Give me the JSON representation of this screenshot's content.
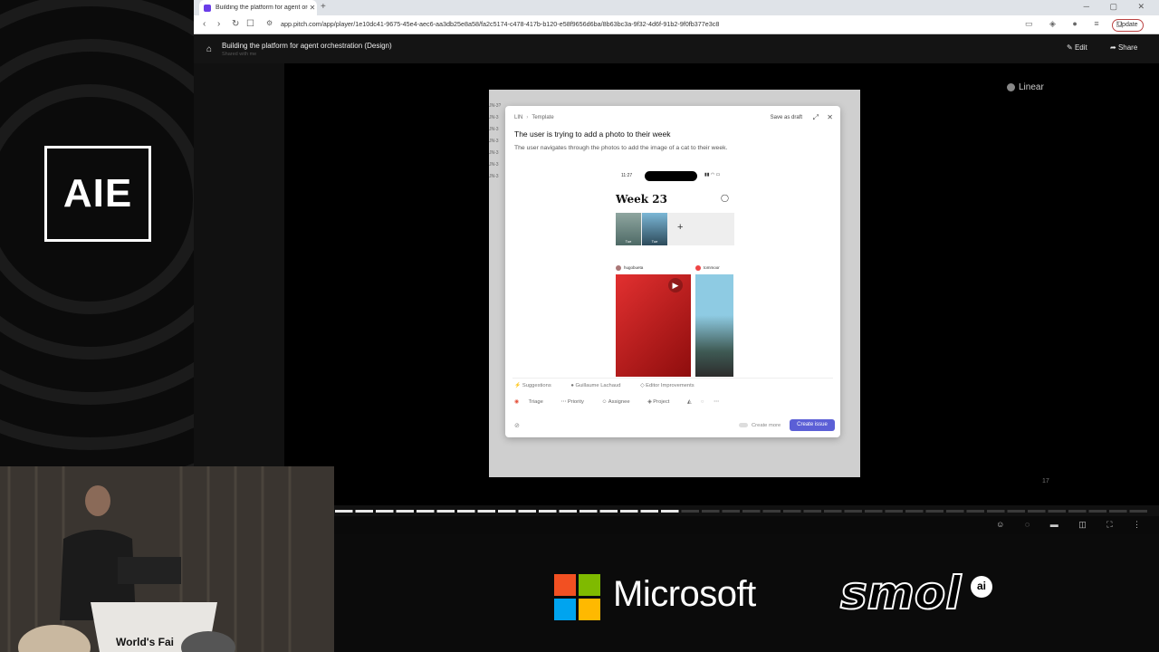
{
  "event_logo": "AIE",
  "browser": {
    "tab_title": "Building the platform for agent orchestration",
    "tab_close": "✕",
    "new_tab": "+",
    "url": "app.pitch.com/app/player/1e10dc41-9675-45e4-aec6-aa3db25e8a58/fa2c5174-c478-417b-b120-e58f9656d6ba/8b63bc3a-9f32-4d6f-91b2-9f0fb377e3c8",
    "update_label": "Update"
  },
  "pitch": {
    "deck_title": "Building the platform for agent orchestration (Design)",
    "deck_subtitle": "Shared with me",
    "edit_label": "Edit",
    "share_label": "Share",
    "linear_label": "Linear",
    "page_number": "17",
    "progress": {
      "total_slides": 40,
      "current_slide": 17
    }
  },
  "slide_sidebar_text": [
    "JN-3?",
    "JN-3",
    "JN-3",
    "JN-3",
    "JN-3",
    "JN-3",
    "JN-3"
  ],
  "modal": {
    "team": "LIN",
    "template": "Template",
    "save_draft": "Save as draft",
    "title": "The user is trying to add a photo to their week",
    "description": "The user navigates through the photos to add the image of a cat to their week.",
    "phone": {
      "time": "11:27",
      "week_title": "Week 23",
      "thumb_labels": [
        "Tue",
        "Tue"
      ],
      "user1": "hugobueta",
      "user2": "tommoor"
    },
    "suggestions_label": "Suggestions",
    "suggestion_assignee": "Guillaume Lachaud",
    "suggestion_project": "Editor Improvements",
    "props": [
      "Triage",
      "Priority",
      "Assignee",
      "Project"
    ],
    "create_more": "Create more",
    "create_issue": "Create issue"
  },
  "webcam": {
    "podium_text": "World's Fai"
  },
  "sponsors": {
    "microsoft": "Microsoft",
    "smol": "smol",
    "smol_ai": "ai"
  },
  "colors": {
    "accent": "#5b5fd6",
    "ms_red": "#f25022",
    "ms_green": "#7fba00",
    "ms_blue": "#00a4ef",
    "ms_yellow": "#ffb900"
  }
}
